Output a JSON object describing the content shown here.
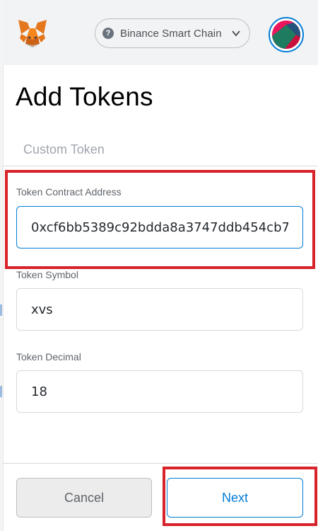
{
  "header": {
    "network": "Binance Smart Chain"
  },
  "page": {
    "title": "Add Tokens",
    "tab": "Custom Token"
  },
  "form": {
    "contract_address": {
      "label": "Token Contract Address",
      "value": "0xcf6bb5389c92bdda8a3747ddb454cb7"
    },
    "symbol": {
      "label": "Token Symbol",
      "value": "xvs"
    },
    "decimal": {
      "label": "Token Decimal",
      "value": "18"
    }
  },
  "footer": {
    "cancel_label": "Cancel",
    "next_label": "Next"
  },
  "colors": {
    "accent": "#037dd6",
    "highlight": "#d8232a",
    "header_bg": "#f2f3f4"
  }
}
